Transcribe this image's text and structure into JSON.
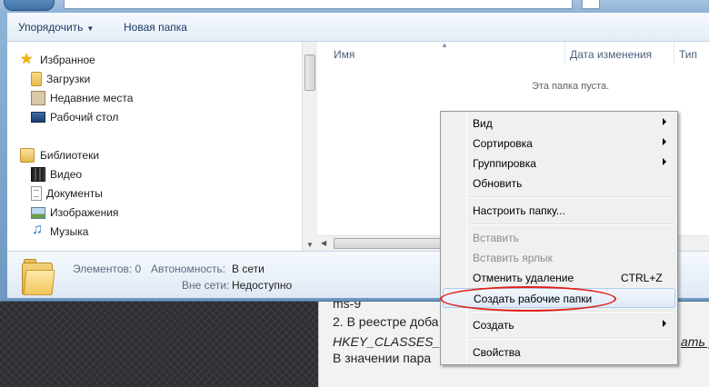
{
  "toolbar": {
    "organize_label": "Упорядочить",
    "new_folder_label": "Новая папка"
  },
  "navigation": {
    "favorites": {
      "label": "Избранное",
      "icon": "star-icon",
      "items": [
        {
          "label": "Загрузки",
          "icon": "downloads-folder-icon"
        },
        {
          "label": "Недавние места",
          "icon": "recent-places-icon"
        },
        {
          "label": "Рабочий стол",
          "icon": "desktop-icon"
        }
      ]
    },
    "libraries": {
      "label": "Библиотеки",
      "icon": "libraries-icon",
      "items": [
        {
          "label": "Видео",
          "icon": "video-icon"
        },
        {
          "label": "Документы",
          "icon": "documents-icon"
        },
        {
          "label": "Изображения",
          "icon": "pictures-icon"
        },
        {
          "label": "Музыка",
          "icon": "music-icon"
        }
      ]
    }
  },
  "file_list": {
    "columns": {
      "name": "Имя",
      "date_modified": "Дата изменения",
      "type": "Тип"
    },
    "empty_message": "Эта папка пуста."
  },
  "details": {
    "items_label": "Элементов: 0",
    "offline_availability_label": "Автономность:",
    "offline_availability_value": "В сети",
    "offline_label": "Вне сети:",
    "offline_value": "Недоступно"
  },
  "context_menu": {
    "view": "Вид",
    "sort": "Сортировка",
    "group": "Группировка",
    "refresh": "Обновить",
    "customize": "Настроить папку...",
    "paste": "Вставить",
    "paste_shortcut": "Вставить ярлык",
    "undo_delete": "Отменить удаление",
    "undo_delete_shortcut": "CTRL+Z",
    "create_work_folders": "Создать рабочие папки",
    "create": "Создать",
    "properties": "Свойства"
  },
  "background_page": {
    "line0": "ms-9",
    "line1": "2. В реестре доба",
    "line2": "HKEY_CLASSES_Ro",
    "line2_right": "ать р",
    "line3": "В значении пара"
  },
  "annotation_color": "#e0201a"
}
